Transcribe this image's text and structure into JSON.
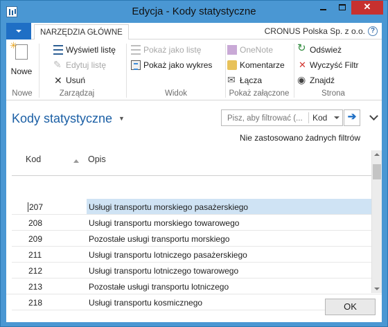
{
  "window": {
    "title": "Edycja - Kody statystyczne",
    "controls": {
      "minimize": "minimize",
      "maximize": "maximize",
      "close": "✕"
    }
  },
  "ribbon": {
    "tab": "NARZĘDZIA GŁÓWNE",
    "company": "CRONUS Polska Sp. z o.o.",
    "help": "?",
    "groups": {
      "nowe": {
        "label": "Nowe",
        "new_button": "Nowe"
      },
      "zarzadzaj": {
        "label": "Zarządzaj",
        "view_list": "Wyświetl listę",
        "edit_list": "Edytuj listę",
        "delete": "Usuń"
      },
      "widok": {
        "label": "Widok",
        "show_as_list": "Pokaż jako listę",
        "show_as_chart": "Pokaż jako wykres"
      },
      "zalaczone": {
        "label": "Pokaż załączone",
        "onenote": "OneNote",
        "comments": "Komentarze",
        "links": "Łącza"
      },
      "strona": {
        "label": "Strona",
        "refresh": "Odśwież",
        "clear_filter": "Wyczyść Filtr",
        "find": "Znajdź"
      }
    }
  },
  "page": {
    "title": "Kody statystyczne",
    "filter": {
      "placeholder": "Pisz, aby filtrować (...",
      "field": "Kod",
      "go": "➔"
    },
    "filter_status": "Nie zastosowano żadnych filtrów"
  },
  "grid": {
    "columns": {
      "code": "Kod",
      "description": "Opis"
    },
    "rows": [
      {
        "code": "207",
        "description": "Usługi transportu morskiego pasażerskiego",
        "selected": true
      },
      {
        "code": "208",
        "description": "Usługi transportu morskiego towarowego"
      },
      {
        "code": "209",
        "description": "Pozostałe usługi transportu morskiego"
      },
      {
        "code": "211",
        "description": "Usługi transportu lotniczego pasażerskiego"
      },
      {
        "code": "212",
        "description": "Usługi transportu lotniczego towarowego"
      },
      {
        "code": "213",
        "description": "Pozostałe usługi transportu lotniczego"
      },
      {
        "code": "218",
        "description": "Usługi transportu kosmicznego"
      }
    ]
  },
  "footer": {
    "ok": "OK"
  },
  "colors": {
    "accent": "#1f6fc5",
    "titlebar": "#4a97d3",
    "selection": "#cfe3f4",
    "close": "#c7312f"
  }
}
